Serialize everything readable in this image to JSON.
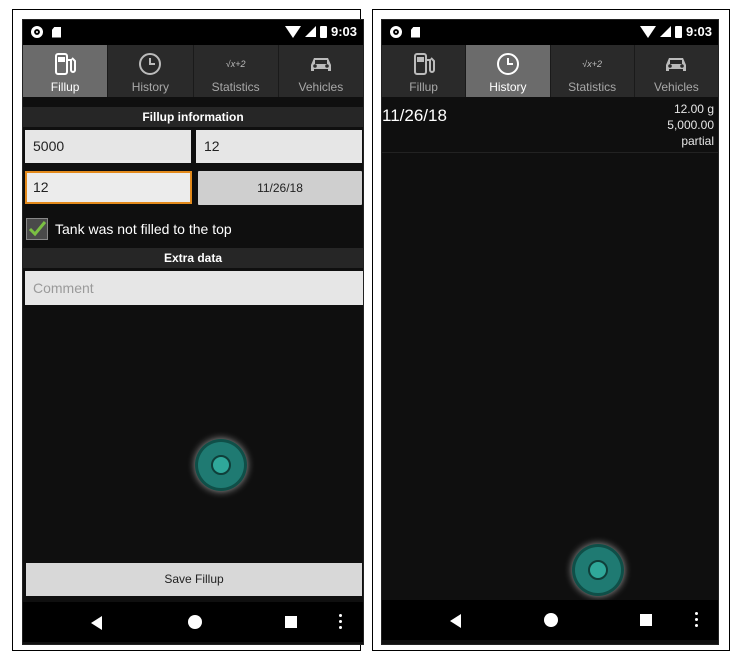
{
  "status": {
    "time": "9:03"
  },
  "tabs": [
    {
      "label": "Fillup",
      "icon": "fuel-pump-icon"
    },
    {
      "label": "History",
      "icon": "clock-icon"
    },
    {
      "label": "Statistics",
      "icon": "formula-icon",
      "icon_text": "√x+2"
    },
    {
      "label": "Vehicles",
      "icon": "car-icon"
    }
  ],
  "fillup_screen": {
    "active_tab": "Fillup",
    "section_fillup": "Fillup information",
    "odometer_value": "5000",
    "volume_value": "12",
    "price_value": "12",
    "date_button": "11/26/18",
    "partial_checkbox": {
      "checked": true,
      "label": "Tank was not filled to the top"
    },
    "section_extra": "Extra data",
    "comment_placeholder": "Comment",
    "save_button": "Save Fillup"
  },
  "history_screen": {
    "active_tab": "History",
    "entries": [
      {
        "date": "11/26/18",
        "volume": "12.00 g",
        "odometer": "5,000.00",
        "type": "partial"
      }
    ]
  },
  "colors": {
    "focus_accent": "#e38a1c",
    "check_green": "#7bc043",
    "fab_teal": "#1f7a72"
  }
}
